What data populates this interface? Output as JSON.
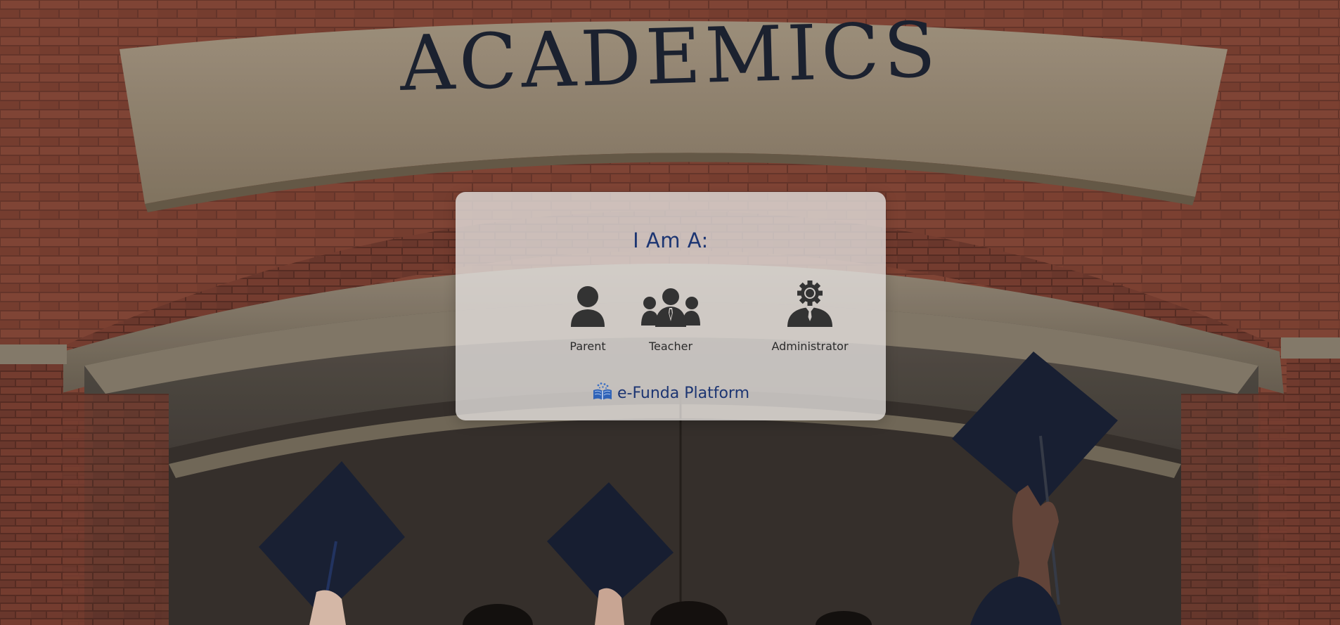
{
  "background": {
    "sign_text": "ACADEMICS"
  },
  "chooser": {
    "title": "I Am A:",
    "roles": [
      {
        "label": "Parent",
        "icon": "person-icon"
      },
      {
        "label": "Teacher",
        "icon": "group-icon"
      },
      {
        "label": "Administrator",
        "icon": "administrator-gear-icon"
      }
    ],
    "brand": {
      "text": "e-Funda Platform",
      "icon": "open-book-logo-icon"
    }
  },
  "colors": {
    "accent": "#1c3572",
    "icon": "#333333",
    "card": "#e2dedc"
  }
}
